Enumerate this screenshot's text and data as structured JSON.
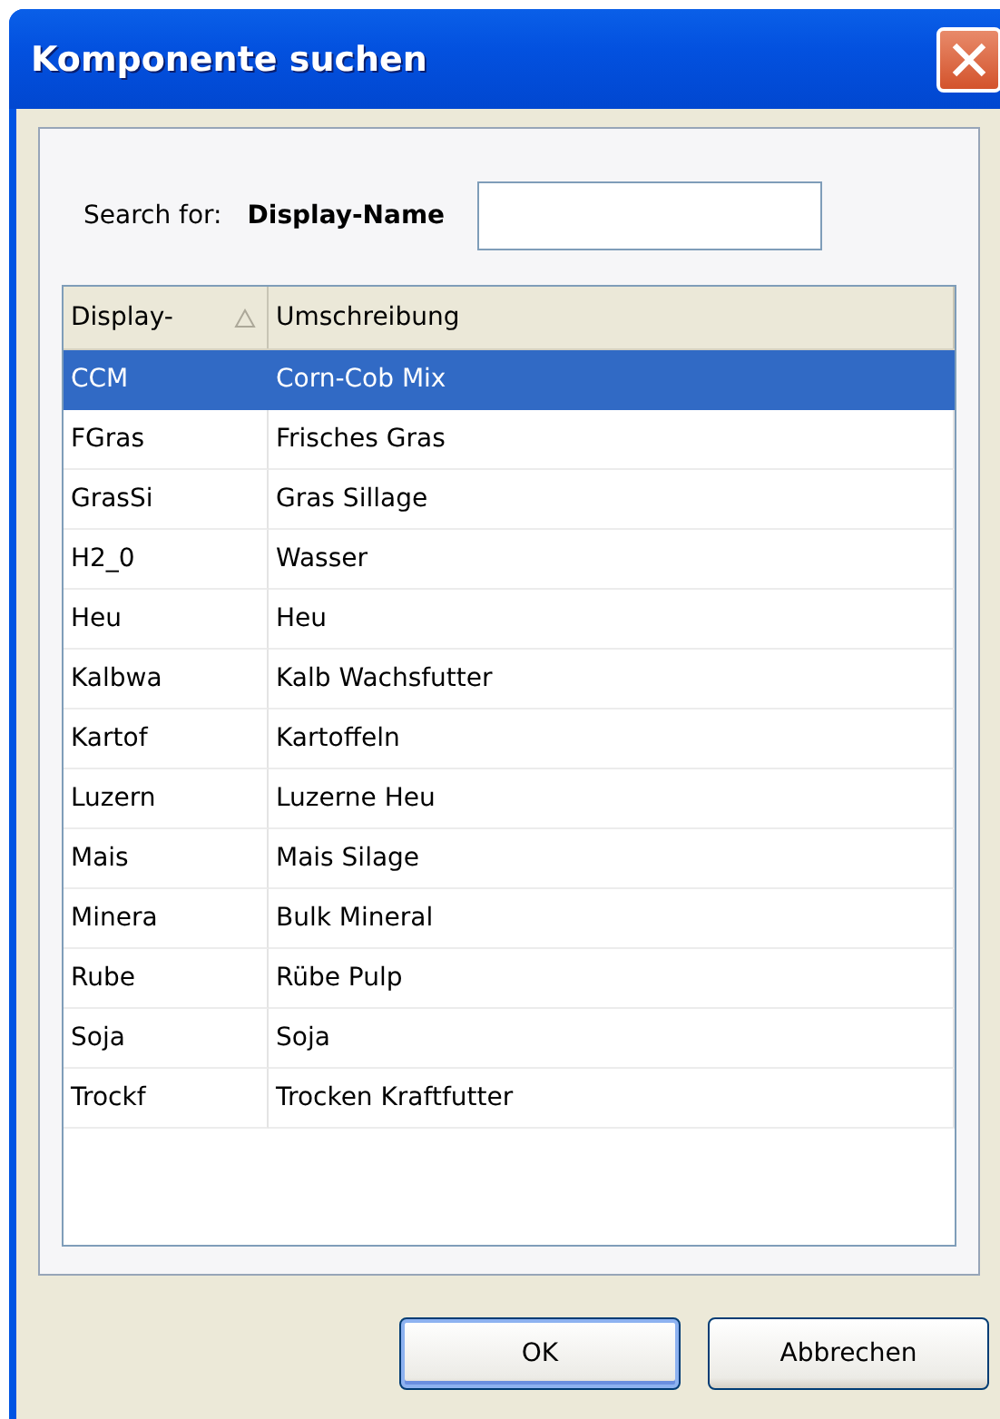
{
  "window": {
    "title": "Komponente suchen"
  },
  "search": {
    "label": "Search for:",
    "field": "Display-Name"
  },
  "table": {
    "columns": [
      {
        "label": "Display-",
        "sorted": true
      },
      {
        "label": "Umschreibung",
        "sorted": false
      }
    ],
    "rows": [
      {
        "cells": [
          "CCM",
          "Corn-Cob Mix"
        ],
        "selected": true
      },
      {
        "cells": [
          "FGras",
          "Frisches Gras"
        ],
        "selected": false
      },
      {
        "cells": [
          "GrasSi",
          "Gras Sillage"
        ],
        "selected": false
      },
      {
        "cells": [
          "H2_0",
          "Wasser"
        ],
        "selected": false
      },
      {
        "cells": [
          "Heu",
          "Heu"
        ],
        "selected": false
      },
      {
        "cells": [
          "Kalbwa",
          "Kalb Wachsfutter"
        ],
        "selected": false
      },
      {
        "cells": [
          "Kartof",
          "Kartoffeln"
        ],
        "selected": false
      },
      {
        "cells": [
          "Luzern",
          "Luzerne Heu"
        ],
        "selected": false
      },
      {
        "cells": [
          "Mais",
          "Mais Silage"
        ],
        "selected": false
      },
      {
        "cells": [
          "Minera",
          "Bulk Mineral"
        ],
        "selected": false
      },
      {
        "cells": [
          "Rube",
          "Rübe Pulp"
        ],
        "selected": false
      },
      {
        "cells": [
          "Soja",
          "Soja"
        ],
        "selected": false
      },
      {
        "cells": [
          "Trockf",
          "Trocken Kraftfutter"
        ],
        "selected": false
      }
    ]
  },
  "buttons": [
    {
      "label": "OK",
      "default": true
    },
    {
      "label": "Abbrechen",
      "default": false
    }
  ]
}
